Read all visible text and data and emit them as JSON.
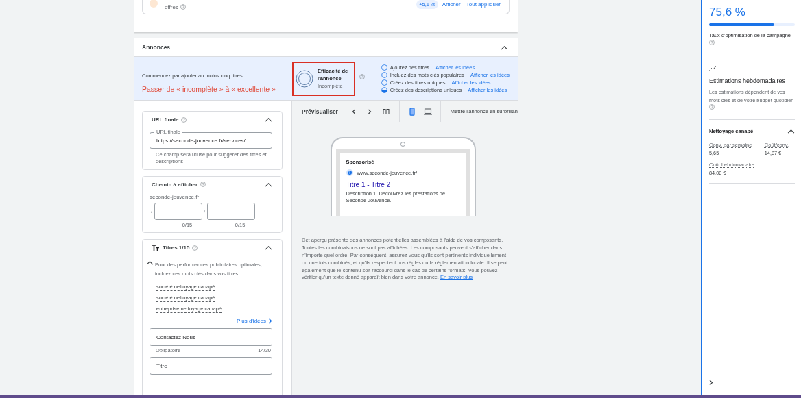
{
  "top_card": {
    "text": "offres",
    "badge": "+5,1 %",
    "links": [
      "Afficher",
      "Tout appliquer"
    ]
  },
  "ads_section": {
    "title": "Annonces",
    "expanded": true,
    "strength": {
      "hint": "Commencez par ajouter au moins cinq titres",
      "annotation": "Passer de « incomplète » à « excellente »",
      "title": "Efficacité de l'annonce",
      "status": "Incomplète",
      "checklist": [
        {
          "label": "Ajoutez des titres",
          "link": "Afficher les idées",
          "in_progress": false
        },
        {
          "label": "Incluez des mots clés populaires",
          "link": "Afficher les idées",
          "in_progress": false
        },
        {
          "label": "Créez des titres uniques",
          "link": "Afficher les idées",
          "in_progress": false
        },
        {
          "label": "Créez des descriptions uniques",
          "link": "Afficher les idées",
          "in_progress": true
        }
      ]
    },
    "url_card": {
      "title": "URL finale",
      "expanded": true,
      "field_label": "URL finale",
      "value": "https://seconde-jouvence.fr/services/",
      "helper": "Ce champ sera utilisé pour suggérer des titres et descriptions"
    },
    "path_card": {
      "title": "Chemin à afficher",
      "expanded": true,
      "domain": "seconde-jouvence.fr",
      "paths": [
        {
          "separator": "/",
          "counter": "0/15"
        },
        {
          "separator": "/",
          "counter": "0/15"
        }
      ]
    },
    "headlines_card": {
      "title": "Titres 1/15",
      "expanded": true,
      "tip": "Pour des performances publicitaires optimales, incluez ces mots clés dans vos titres",
      "tip_expanded": true,
      "keywords": [
        "société nettoyage canapé",
        "société nettoyage canapé",
        "entreprise nettoyage canapé"
      ],
      "more_link": "Plus d'idées",
      "fields": [
        {
          "value": "Contactez Nous",
          "helper": "Obligatoire",
          "counter": "14/30"
        },
        {
          "placeholder": "Titre"
        }
      ]
    },
    "preview": {
      "title": "Prévisualiser",
      "devices": [
        {
          "kind": "mobile",
          "selected": true
        },
        {
          "kind": "desktop",
          "selected": false
        }
      ],
      "highlight_label": "Mettre l'annonce en surbrillan",
      "ad": {
        "label": "Sponsorisé",
        "url": "www.seconde-jouvence.fr/",
        "headline": "Titre 1 - Titre 2",
        "description": "Description 1. Découvrez les prestations de Seconde Jouvence."
      },
      "disclaimer": "Cet aperçu présente des annonces potentielles assemblées à l'aide de vos composants. Toutes les combinaisons ne sont pas affichées. Les composants peuvent s'afficher dans n'importe quel ordre. Par conséquent, assurez-vous qu'ils sont pertinents individuellement ou une fois combinés, et qu'ils respectent nos règles ou la réglementation locale. Il se peut également que le contenu soit raccourci dans le cas de certains formats. Vous pouvez vérifier qu'un texte donné apparaît bien dans votre annonce.",
      "learn_more": "En savoir plus"
    }
  },
  "side_panel": {
    "score": "75,6 %",
    "level": 0.756,
    "score_label": "Taux d'optimisation de la campagne",
    "estimates_title": "Estimations hebdomadaires",
    "estimates_text": "Les estimations dépendent de vos mots clés et de votre budget quotidien",
    "keyword_group": {
      "title": "Nettoyage canapé",
      "expanded": true,
      "metrics": [
        {
          "label": "Conv. par semaine",
          "value": "5,65"
        },
        {
          "label": "Coût/conv.",
          "value": "14,87 €"
        },
        {
          "label": "Coût hebdomadaire",
          "value": "84,00 €"
        }
      ]
    }
  }
}
